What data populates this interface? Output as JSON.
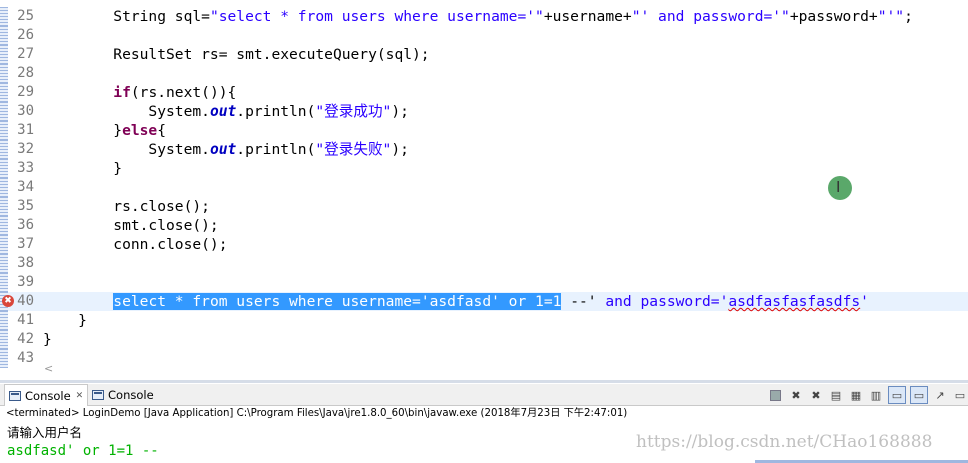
{
  "editor": {
    "lines": [
      {
        "num": "25",
        "segments": [
          {
            "t": "        String sql=",
            "c": "plain"
          },
          {
            "t": "\"select * from users where username='\"",
            "c": "str"
          },
          {
            "t": "+username+",
            "c": "plain"
          },
          {
            "t": "\"' and password='\"",
            "c": "str"
          },
          {
            "t": "+password+",
            "c": "plain"
          },
          {
            "t": "\"'\"",
            "c": "str"
          },
          {
            "t": ";",
            "c": "plain"
          }
        ]
      },
      {
        "num": "26",
        "segments": []
      },
      {
        "num": "27",
        "segments": [
          {
            "t": "        ResultSet rs= smt.executeQuery(sql);",
            "c": "plain"
          }
        ]
      },
      {
        "num": "28",
        "segments": []
      },
      {
        "num": "29",
        "segments": [
          {
            "t": "        ",
            "c": "plain"
          },
          {
            "t": "if",
            "c": "kw"
          },
          {
            "t": "(rs.next()){",
            "c": "plain"
          }
        ]
      },
      {
        "num": "30",
        "segments": [
          {
            "t": "            System.",
            "c": "plain"
          },
          {
            "t": "out",
            "c": "fld"
          },
          {
            "t": ".println(",
            "c": "plain"
          },
          {
            "t": "\"登录成功\"",
            "c": "str"
          },
          {
            "t": ");",
            "c": "plain"
          }
        ]
      },
      {
        "num": "31",
        "segments": [
          {
            "t": "        }",
            "c": "plain"
          },
          {
            "t": "else",
            "c": "kw"
          },
          {
            "t": "{",
            "c": "plain"
          }
        ]
      },
      {
        "num": "32",
        "segments": [
          {
            "t": "            System.",
            "c": "plain"
          },
          {
            "t": "out",
            "c": "fld"
          },
          {
            "t": ".println(",
            "c": "plain"
          },
          {
            "t": "\"登录失败\"",
            "c": "str"
          },
          {
            "t": ");",
            "c": "plain"
          }
        ]
      },
      {
        "num": "33",
        "segments": [
          {
            "t": "        }",
            "c": "plain"
          }
        ]
      },
      {
        "num": "34",
        "segments": []
      },
      {
        "num": "35",
        "segments": [
          {
            "t": "        rs.close();",
            "c": "plain"
          }
        ]
      },
      {
        "num": "36",
        "segments": [
          {
            "t": "        smt.close();",
            "c": "plain"
          }
        ]
      },
      {
        "num": "37",
        "segments": [
          {
            "t": "        conn.close();",
            "c": "plain"
          }
        ]
      },
      {
        "num": "38",
        "segments": []
      },
      {
        "num": "39",
        "segments": []
      },
      {
        "num": "40",
        "current": true,
        "error": true,
        "segments": [
          {
            "t": "        ",
            "c": "plain"
          },
          {
            "t": "select * from users where username='asdfasd' or 1=1",
            "c": "sel"
          },
          {
            "t": " --'",
            "c": "plain"
          },
          {
            "t": " and password='",
            "c": "str"
          },
          {
            "t": "asdfasfasfasdfs",
            "c": "str sq"
          },
          {
            "t": "'",
            "c": "str"
          }
        ]
      },
      {
        "num": "41",
        "segments": [
          {
            "t": "    }",
            "c": "plain"
          }
        ]
      },
      {
        "num": "42",
        "segments": [
          {
            "t": "}",
            "c": "plain"
          }
        ]
      },
      {
        "num": "43",
        "segments": []
      }
    ],
    "scroll_indicator": "<",
    "error_marker_symbol": "✖",
    "cursor_glyph": "I"
  },
  "console": {
    "tabs": [
      {
        "label": "Console",
        "close": "✕",
        "active": true
      },
      {
        "label": "Console",
        "active": false
      }
    ],
    "toolbar_icons": [
      "stop-icon",
      "remove-launch-icon",
      "remove-all-icon",
      "scroll-lock-icon",
      "show-on-output-icon",
      "word-wrap-icon",
      "display-selected-console-icon",
      "open-console-icon",
      "pin-console-icon",
      "new-console-icon"
    ],
    "status": "<terminated> LoginDemo [Java Application] C:\\Program Files\\Java\\jre1.8.0_60\\bin\\javaw.exe (2018年7月23日 下午2:47:01)",
    "output_line1": "请输入用户名",
    "output_line2": "asdfasd' or 1=1 --"
  },
  "watermark": "https://blog.csdn.net/CHao168888",
  "colors": {
    "keyword": "#7f0055",
    "string": "#2a00ff",
    "field": "#0000c0",
    "selection": "#3399ff",
    "console_input": "#00b200"
  }
}
